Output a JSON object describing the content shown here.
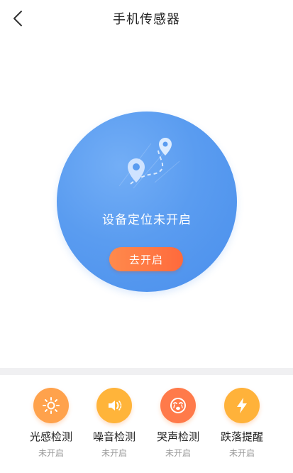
{
  "header": {
    "title": "手机传感器"
  },
  "location": {
    "status_text": "设备定位未开启",
    "button_label": "去开启"
  },
  "sensors": [
    {
      "label": "光感检测",
      "state": "未开启",
      "icon": "sun-icon",
      "color": "#ffa24c"
    },
    {
      "label": "噪音检测",
      "state": "未开启",
      "icon": "speaker-icon",
      "color": "#ffb43a"
    },
    {
      "label": "哭声检测",
      "state": "未开启",
      "icon": "crying-face-icon",
      "color": "#ff7a4a"
    },
    {
      "label": "跌落提醒",
      "state": "未开启",
      "icon": "lightning-icon",
      "color": "#ffb23a"
    }
  ],
  "colors": {
    "accent_blue": "#5a9cf0",
    "button_orange": "#ff7a45",
    "muted_text": "#9a9a9a"
  }
}
